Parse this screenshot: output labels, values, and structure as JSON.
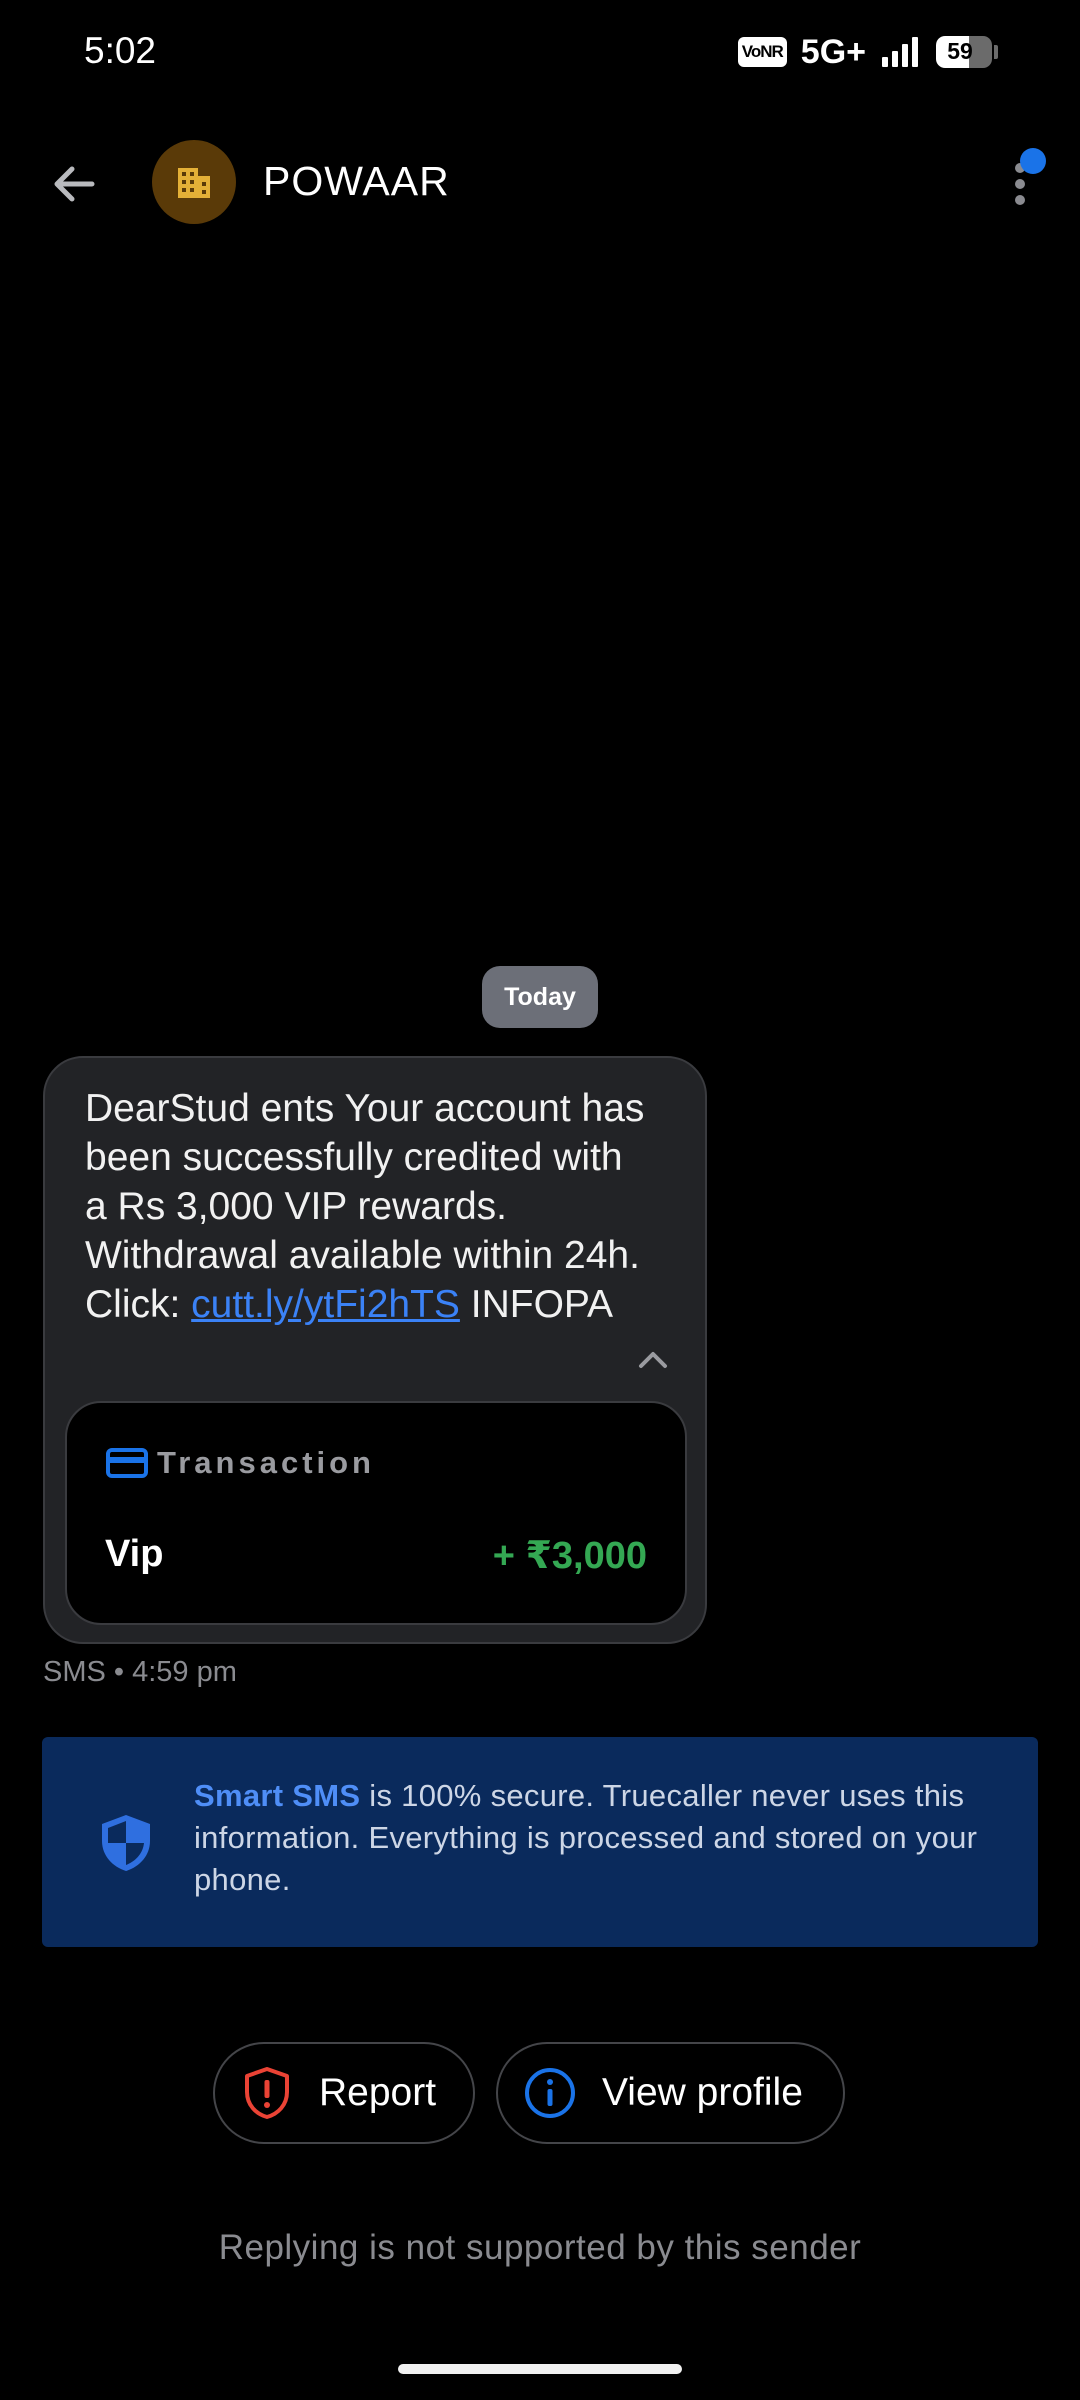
{
  "status_bar": {
    "time": "5:02",
    "vonr": "VoNR",
    "network": "5G+",
    "battery": "59",
    "battery_level": 0.59
  },
  "header": {
    "sender_name": "POWAAR",
    "back_icon": "arrow-left-icon",
    "avatar_icon": "building-icon",
    "more_icon": "more-vertical-icon"
  },
  "conversation": {
    "date_chip": "Today",
    "message": {
      "text_before_link": "DearStud ents Your account has been successfully credited with a Rs 3,000 VIP rewards. Withdrawal available within 24h. Click: ",
      "link": "cutt.ly/ytFi2hTS",
      "text_after_link": " INFOPA",
      "collapse_icon": "chevron-up-icon",
      "transaction": {
        "icon": "credit-card-icon",
        "title": "Transaction",
        "name": "Vip",
        "amount": "+ ₹3,000"
      },
      "meta": "SMS • 4:59 pm"
    }
  },
  "smart_sms_banner": {
    "icon": "shield-icon",
    "brand": "Smart SMS",
    "text": " is 100% secure. Truecaller never uses this information. Everything is processed and stored on your phone."
  },
  "actions": {
    "report_label": "Report",
    "report_icon": "alert-shield-icon",
    "view_profile_label": "View profile",
    "view_profile_icon": "info-icon"
  },
  "reply_note": "Replying is not supported by this sender",
  "colors": {
    "background": "#000000",
    "bubble": "#222326",
    "link": "#3b82f6",
    "amount": "#34a853",
    "banner": "#0a2a5c",
    "accent_blue": "#1a73e8",
    "report_red": "#ea4335"
  }
}
